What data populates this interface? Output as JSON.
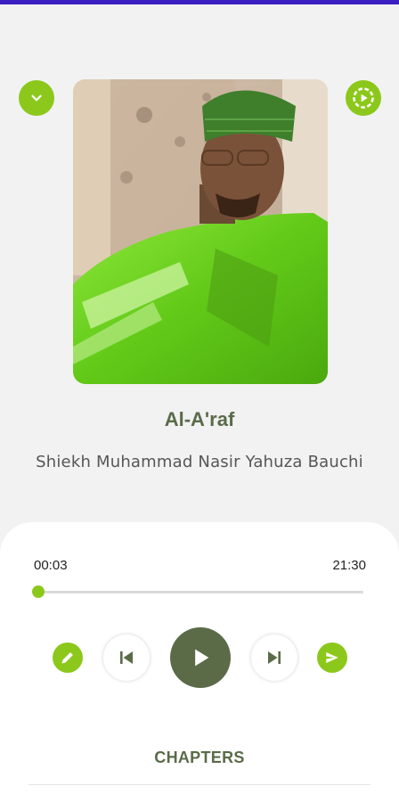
{
  "colors": {
    "accent": "#8cc81b",
    "primary_dark": "#5b6b48",
    "status_bar": "#3b1fc2",
    "sheet_background": "#ffffff",
    "page_background": "#f2f2f2"
  },
  "header": {
    "collapse_icon": "chevron-down-icon",
    "cast_icon": "play-circle-icon"
  },
  "artwork": {
    "kind": "speaker-portrait",
    "description_visible": false
  },
  "track": {
    "title": "Al-A'raf",
    "artist": "Shiekh Muhammad Nasir Yahuza Bauchi"
  },
  "player": {
    "elapsed": "00:03",
    "duration": "21:30",
    "progress_fraction": 0.0023,
    "controls": {
      "edit_icon": "pencil-icon",
      "previous_icon": "skip-previous-icon",
      "play_icon": "play-icon",
      "next_icon": "skip-next-icon",
      "share_icon": "send-icon"
    }
  },
  "chapters": {
    "label": "CHAPTERS"
  }
}
